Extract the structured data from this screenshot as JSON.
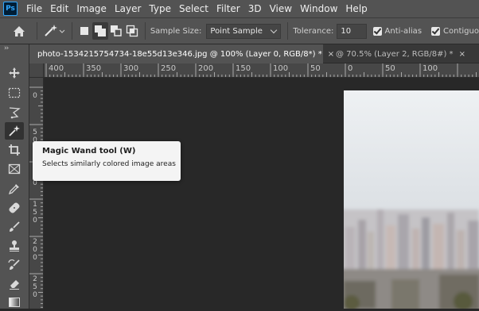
{
  "app": {
    "logo_text": "Ps"
  },
  "menu": [
    "File",
    "Edit",
    "Image",
    "Layer",
    "Type",
    "Select",
    "Filter",
    "3D",
    "View",
    "Window",
    "Help"
  ],
  "options": {
    "sample_size_label": "Sample Size:",
    "sample_size_value": "Point Sample",
    "tolerance_label": "Tolerance:",
    "tolerance_value": "10",
    "anti_alias_label": "Anti-alias",
    "contiguous_label": "Contiguo"
  },
  "tabs": [
    {
      "label": "photo-1534215754734-18e55d13e346.jpg @ 100% (Layer 0, RGB/8*) *",
      "close": "×",
      "active": true
    },
    {
      "label": "@ 70.5% (Layer 2, RGB/8#) *",
      "close": "×",
      "active": false
    }
  ],
  "ruler": {
    "horizontal": [
      "400",
      "350",
      "300",
      "250",
      "200",
      "150",
      "100",
      "50",
      "0",
      "50",
      "100"
    ],
    "vertical": [
      "0",
      "5\n0",
      "1\n0\n0",
      "1\n5\n0",
      "2\n0\n0",
      "2\n5\n0"
    ]
  },
  "tooltip": {
    "title": "Magic Wand tool (W)",
    "description": "Selects similarly colored image areas"
  },
  "toolbar": {
    "tools": [
      "move-tool",
      "marquee-tool",
      "lasso-tool",
      "magic-wand-tool",
      "crop-tool",
      "frame-tool",
      "eyedropper-tool",
      "healing-brush-tool",
      "brush-tool",
      "clone-stamp-tool",
      "history-brush-tool",
      "eraser-tool",
      "gradient-tool"
    ],
    "active": "magic-wand-tool"
  },
  "colors": {
    "chrome": "#535353",
    "canvas_bg": "#282828",
    "ps_blue": "#31a8ff"
  }
}
